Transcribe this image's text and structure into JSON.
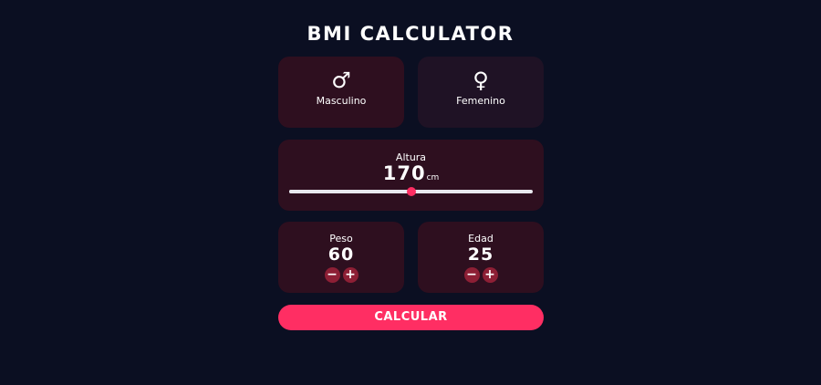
{
  "app": {
    "title": "BMI CALCULATOR"
  },
  "gender": {
    "selected": "male",
    "male": {
      "symbol": "♂",
      "label": "Masculino",
      "icon": "male-symbol-icon"
    },
    "female": {
      "symbol": "♀",
      "label": "Femenino",
      "icon": "female-symbol-icon"
    }
  },
  "height": {
    "label": "Altura",
    "value": "170",
    "unit": "cm",
    "slider_fraction": 0.5
  },
  "weight": {
    "label": "Peso",
    "value": "60",
    "decrement": "−",
    "increment": "+"
  },
  "age": {
    "label": "Edad",
    "value": "25",
    "decrement": "−",
    "increment": "+"
  },
  "actions": {
    "calculate_label": "CALCULAR"
  },
  "colors": {
    "background": "#0b0f22",
    "card_active": "#2e0f1f",
    "card_inactive": "#1f1225",
    "accent": "#ff2e63",
    "stepper": "#8d1f35",
    "text": "#ffffff"
  }
}
